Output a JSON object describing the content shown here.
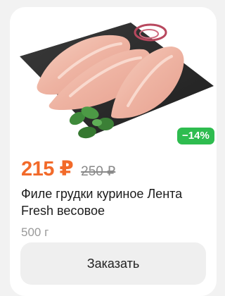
{
  "product": {
    "image_alt": "chicken-breast-fillet-photo",
    "discount_label": "−14%",
    "price_current": "215 ₽",
    "price_old": "250 ₽",
    "title": "Филе грудки куриное Лента Fresh весовое",
    "weight": "500 г",
    "order_label": "Заказать"
  },
  "colors": {
    "price_accent": "#f26a2a",
    "discount_badge": "#2ebc4f",
    "button_bg": "#efefef",
    "card_bg": "#ffffff"
  }
}
